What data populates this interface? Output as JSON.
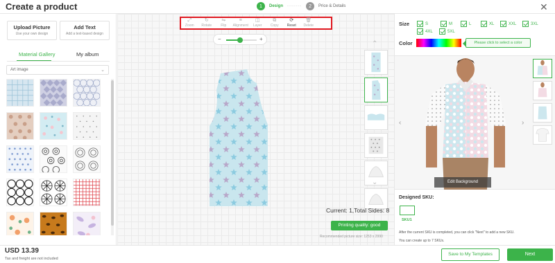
{
  "header": {
    "title": "Create a product",
    "steps": [
      {
        "num": "1",
        "label": "Design"
      },
      {
        "num": "2",
        "label": "Price & Details"
      }
    ],
    "close": "✕"
  },
  "left": {
    "upload": {
      "title": "Upload Picture",
      "sub": "Use your own design"
    },
    "add_text": {
      "title": "Add Text",
      "sub": "Add a text-based design"
    },
    "tabs": [
      "Material Gallery",
      "My album"
    ],
    "select_value": "Art image"
  },
  "toolbar": {
    "tools": [
      {
        "icon": "⤢",
        "label": "Zoom"
      },
      {
        "icon": "↻",
        "label": "Rotate"
      },
      {
        "icon": "⇋",
        "label": "Flip"
      },
      {
        "icon": "≡",
        "label": "Alignment"
      },
      {
        "icon": "◫",
        "label": "Layer"
      },
      {
        "icon": "⧉",
        "label": "Copy"
      },
      {
        "icon": "⟳",
        "label": "Reset"
      },
      {
        "icon": "🗑",
        "label": "Delete"
      }
    ],
    "zoom_minus": "−",
    "zoom_plus": "+",
    "zoom_level": 0.45
  },
  "canvas": {
    "current_text": "Current: 1,Total Sides: 8",
    "print_quality": "Printing quality: good",
    "recommended": "Recommended picture size: 1253 x 2990"
  },
  "right": {
    "size_label": "Size",
    "sizes": [
      "S",
      "M",
      "L",
      "XL",
      "XXL",
      "3XL",
      "4XL",
      "5XL"
    ],
    "color_label": "Color",
    "color_tip": "Please click to select a color",
    "edit_background": "Edit Background",
    "designed_sku_label": "Designed SKU:",
    "sku_name": "SKU1",
    "notes": [
      "After the current SKU is completed, you can click \"Next\" to add a new SKU.",
      "You can create up to 7 SKUs."
    ]
  },
  "footer": {
    "price": "USD 13.39",
    "tax": "Tax and freight are not included",
    "save_label": "Save to My Templates",
    "next_label": "Next"
  },
  "colors": {
    "accent": "#3cb34a",
    "highlight_border": "#e0171f",
    "shirt_blue": "#cde7ee",
    "shirt_pink": "#f3dbe4"
  }
}
